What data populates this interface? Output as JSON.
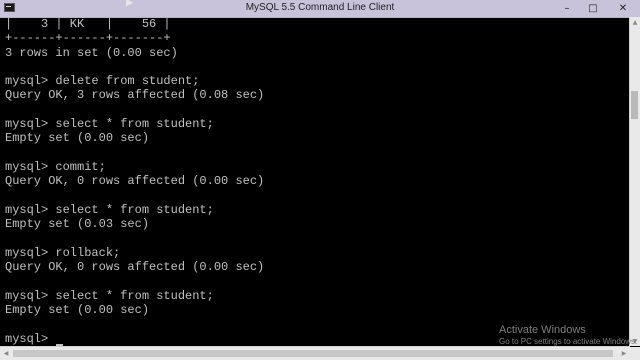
{
  "window": {
    "title": "MySQL 5.5 Command Line Client",
    "icon": "console-icon",
    "controls": {
      "minimize": "–",
      "maximize": "□",
      "close": "✕"
    }
  },
  "console": {
    "lines": [
      "|    3 | KK   |    56 |",
      "+------+------+-------+",
      "3 rows in set (0.00 sec)",
      "",
      "mysql> delete from student;",
      "Query OK, 3 rows affected (0.08 sec)",
      "",
      "mysql> select * from student;",
      "Empty set (0.00 sec)",
      "",
      "mysql> commit;",
      "Query OK, 0 rows affected (0.00 sec)",
      "",
      "mysql> select * from student;",
      "Empty set (0.03 sec)",
      "",
      "mysql> rollback;",
      "Query OK, 0 rows affected (0.00 sec)",
      "",
      "mysql> select * from student;",
      "Empty set (0.00 sec)",
      "",
      "mysql> "
    ]
  },
  "scrollbars": {
    "up_arrow": "▲",
    "down_arrow": "▼",
    "left_arrow": "◀",
    "right_arrow": "▶"
  },
  "watermark": {
    "title": "Activate Windows",
    "subtitle": "Go to PC settings to activate Windows."
  },
  "colors": {
    "console_background": "#000000",
    "console_text": "#c0c0c0",
    "titlebar": "#c8c3da"
  }
}
